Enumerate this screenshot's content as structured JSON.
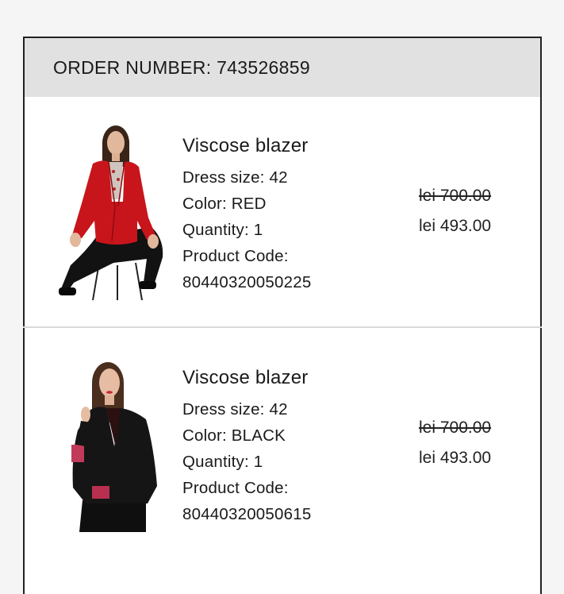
{
  "order": {
    "title": "ORDER NUMBER: 743526859"
  },
  "items": [
    {
      "name": "Viscose blazer",
      "size": "Dress size: 42",
      "color": "Color: RED",
      "quantity": "Quantity: 1",
      "code_label": "Product Code:",
      "code": "80440320050225",
      "old_price": "lei 700.00",
      "new_price": "lei 493.00",
      "jacket_color": "#c8151c",
      "image": "woman-in-red-blazer"
    },
    {
      "name": "Viscose blazer",
      "size": "Dress size: 42",
      "color": "Color: BLACK",
      "quantity": "Quantity: 1",
      "code_label": "Product Code:",
      "code": "80440320050615",
      "old_price": "lei 700.00",
      "new_price": "lei 493.00",
      "jacket_color": "#151515",
      "image": "woman-in-black-blazer"
    }
  ]
}
